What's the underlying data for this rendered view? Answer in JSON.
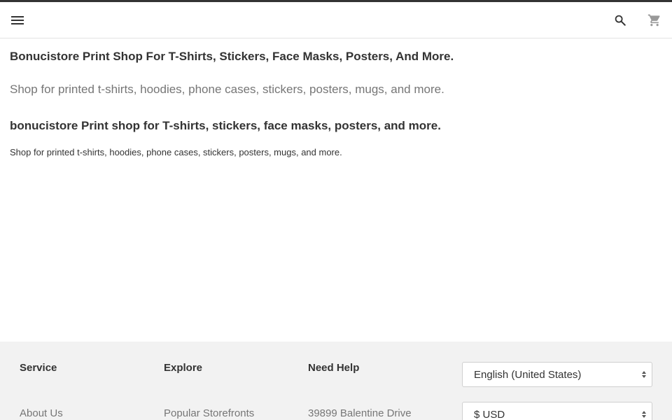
{
  "header": {
    "menu_icon": "hamburger-menu-icon",
    "search_icon": "search-icon",
    "cart_icon": "shopping-cart-icon"
  },
  "main": {
    "title_1": "Bonucistore Print Shop For T-Shirts, Stickers, Face Masks, Posters, And More.",
    "subtitle_1": "Shop for printed t-shirts, hoodies, phone cases, stickers, posters, mugs, and more.",
    "title_2": "bonucistore Print shop for T-shirts, stickers, face masks, posters, and more.",
    "subtitle_2": "Shop for printed t-shirts, hoodies, phone cases, stickers, posters, mugs, and more."
  },
  "footer": {
    "columns": [
      {
        "heading": "Service",
        "first_link": "About Us"
      },
      {
        "heading": "Explore",
        "first_link": "Popular Storefronts"
      },
      {
        "heading": "Need Help",
        "first_link": "39899 Balentine Drive"
      }
    ],
    "language_select": {
      "value": "English (United States)"
    },
    "currency_select": {
      "value": "$ USD"
    }
  },
  "colors": {
    "accent_bar": "#333333",
    "footer_bg": "#f2f2f2",
    "muted_text": "#767676"
  }
}
